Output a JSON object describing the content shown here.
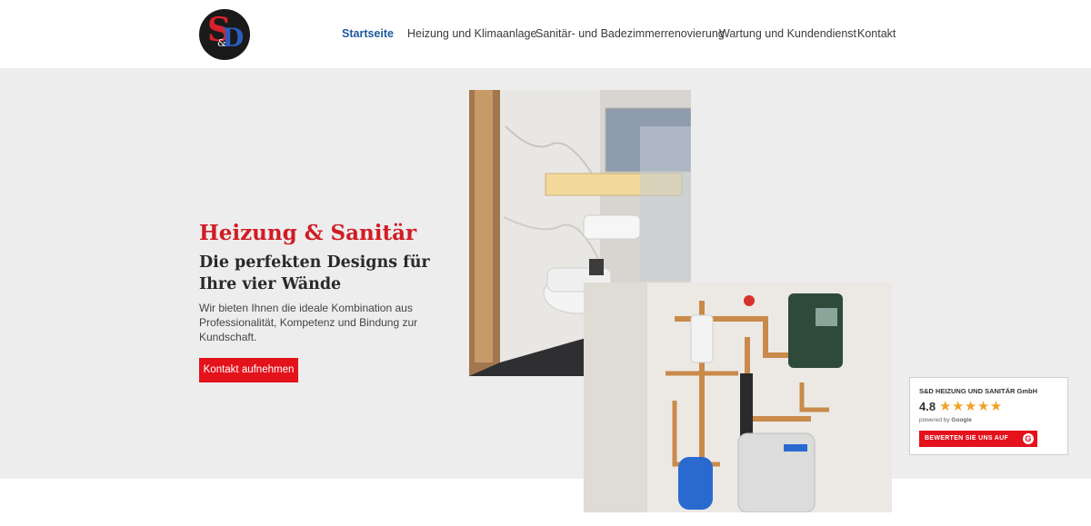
{
  "header": {
    "logo": {
      "text_s": "S",
      "text_amp": "&",
      "text_d": "D"
    },
    "nav": [
      {
        "label": "Startseite",
        "active": true
      },
      {
        "label": "Heizung und Klimaanlage",
        "active": false
      },
      {
        "label": "Sanitär- und Badezimmerrenovierung",
        "active": false
      },
      {
        "label": "Wartung und Kundendienst",
        "active": false
      },
      {
        "label": "Kontakt",
        "active": false
      }
    ]
  },
  "hero": {
    "title": "Heizung & Sanitär",
    "subtitle": "Die perfekten Designs für Ihre vier Wände",
    "description": "Wir bieten Ihnen die ideale Kombination aus Professionalität, Kompetenz und Bindung zur Kundschaft.",
    "cta_label": "Kontakt aufnehmen"
  },
  "review_widget": {
    "company": "S&D HEIZUNG UND SANITÄR GmbH",
    "rating": "4.8",
    "stars": "★★★★★",
    "rating_value": 4.8,
    "powered_by": "powered by",
    "powered_brand": "Google",
    "button_label": "BEWERTEN SIE UNS AUF",
    "button_icon": "G"
  },
  "colors": {
    "brand_red": "#e3121b",
    "title_red": "#d01c24",
    "nav_active": "#1e5aa0",
    "hero_bg": "#ededed",
    "star": "#f0a226"
  }
}
